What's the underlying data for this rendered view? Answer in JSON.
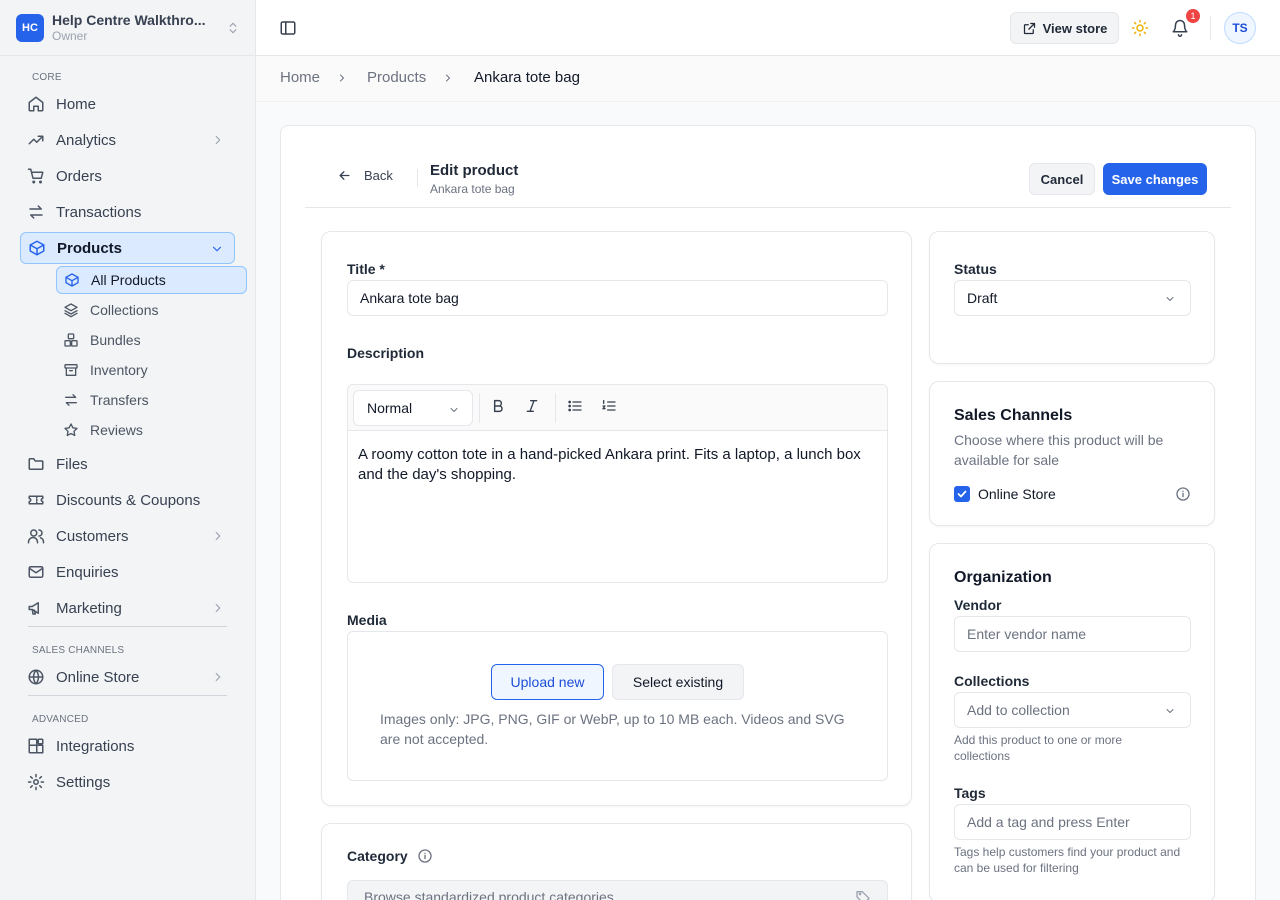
{
  "workspace": {
    "badge": "HC",
    "name": "Help Centre Walkthro...",
    "role": "Owner"
  },
  "sidebar": {
    "core_label": "CORE",
    "items": [
      {
        "label": "Home"
      },
      {
        "label": "Analytics"
      },
      {
        "label": "Orders"
      },
      {
        "label": "Transactions"
      },
      {
        "label": "Products"
      }
    ],
    "product_sub": [
      {
        "label": "All Products"
      },
      {
        "label": "Collections"
      },
      {
        "label": "Bundles"
      },
      {
        "label": "Inventory"
      },
      {
        "label": "Transfers"
      },
      {
        "label": "Reviews"
      }
    ],
    "items2": [
      {
        "label": "Files"
      },
      {
        "label": "Discounts & Coupons"
      },
      {
        "label": "Customers"
      },
      {
        "label": "Enquiries"
      },
      {
        "label": "Marketing"
      }
    ],
    "sales_label": "SALES CHANNELS",
    "online_store": "Online Store",
    "advanced_label": "ADVANCED",
    "integrations": "Integrations",
    "settings": "Settings"
  },
  "topbar": {
    "view_store": "View store",
    "notifications": "1",
    "avatar": "TS"
  },
  "breadcrumb": {
    "home": "Home",
    "products": "Products",
    "current": "Ankara tote bag"
  },
  "header": {
    "back": "Back",
    "title": "Edit product",
    "subtitle": "Ankara tote bag",
    "cancel": "Cancel",
    "save": "Save changes"
  },
  "form": {
    "title_label": "Title *",
    "title_value": "Ankara tote bag",
    "description_label": "Description",
    "format_value": "Normal",
    "description_text": "A roomy cotton tote in a hand-picked Ankara print. Fits a laptop, a lunch box and the day's shopping.",
    "media_label": "Media",
    "upload_new": "Upload new",
    "select_existing": "Select existing",
    "media_help": "Images only: JPG, PNG, GIF or WebP, up to 10 MB each. Videos and SVG are not accepted.",
    "category_label": "Category",
    "category_placeholder": "Browse standardized product categories"
  },
  "status": {
    "label": "Status",
    "value": "Draft"
  },
  "sales_channels": {
    "title": "Sales Channels",
    "desc": "Choose where this product will be available for sale",
    "online_store": "Online Store",
    "online_store_checked": true
  },
  "organization": {
    "title": "Organization",
    "vendor_label": "Vendor",
    "vendor_placeholder": "Enter vendor name",
    "collections_label": "Collections",
    "collections_placeholder": "Add to collection",
    "collections_help": "Add this product to one or more collections",
    "tags_label": "Tags",
    "tags_placeholder": "Add a tag and press Enter",
    "tags_help": "Tags help customers find your product and can be used for filtering"
  },
  "colors": {
    "accent": "#2563eb",
    "accent_light": "#dbeafe",
    "sidebar_bg": "#f3f4f6",
    "badge_red": "#ef4444",
    "sun": "#eab308"
  }
}
